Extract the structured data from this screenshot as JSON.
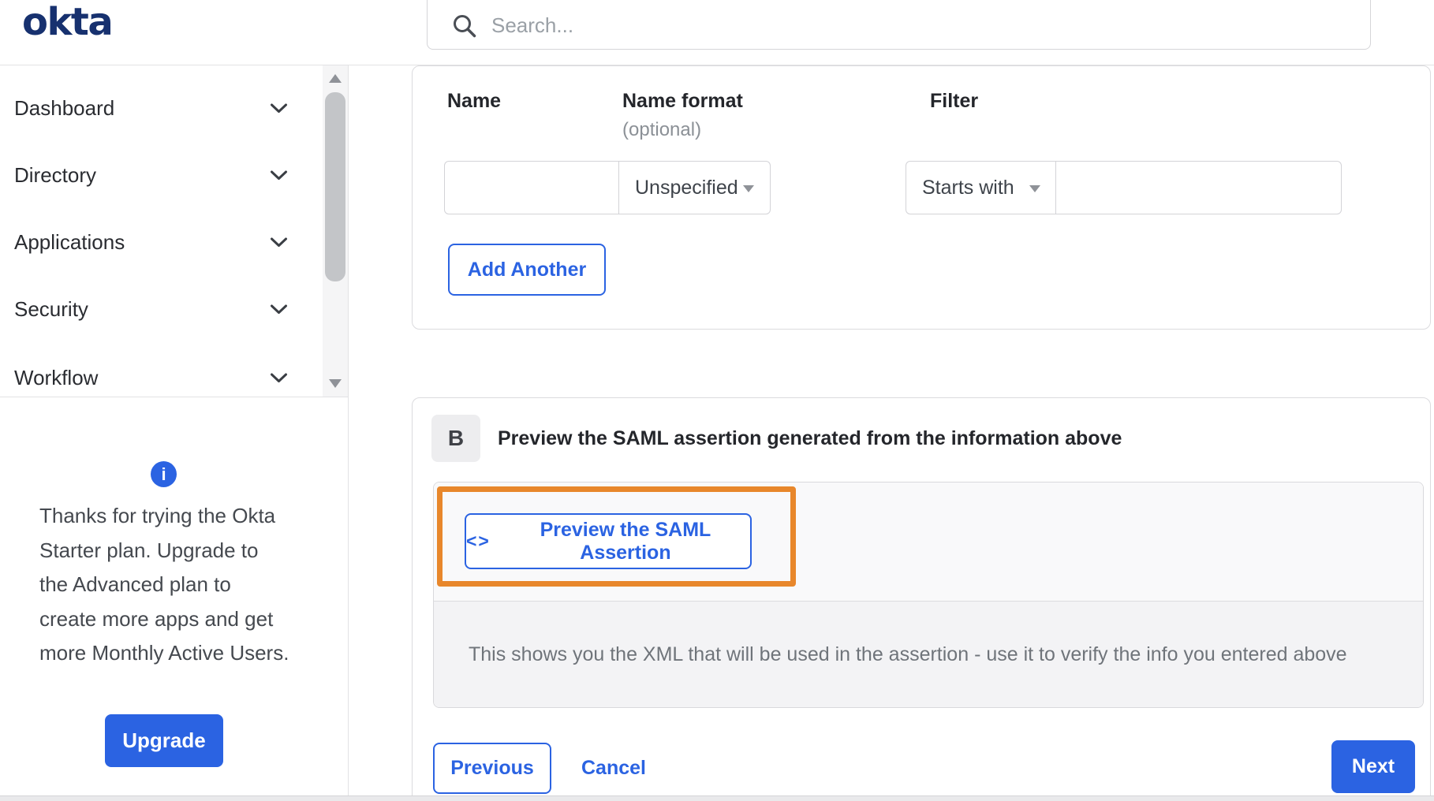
{
  "brand": {
    "logo_text": "okta"
  },
  "search": {
    "placeholder": "Search..."
  },
  "icons": {
    "info_glyph": "i"
  },
  "sidebar": {
    "items": [
      "Dashboard",
      "Directory",
      "Applications",
      "Security",
      "Workflow"
    ],
    "plan_notice_lines": [
      "Thanks for trying the Okta",
      "Starter plan. Upgrade to",
      "the Advanced plan to",
      "create more apps and get",
      "more Monthly Active Users."
    ],
    "upgrade_label": "Upgrade"
  },
  "attribute_form": {
    "name_label": "Name",
    "name_format_label": "Name format",
    "name_format_sublabel": "(optional)",
    "filter_label": "Filter",
    "name_value": "",
    "name_format_value": "Unspecified",
    "filter_operator_value": "Starts with",
    "filter_value": "",
    "add_another_label": "Add Another"
  },
  "preview_section": {
    "badge": "B",
    "title": "Preview the SAML assertion generated from the information above",
    "preview_button_icon": "<>",
    "preview_button_label": "Preview the SAML Assertion",
    "description": "This shows you the XML that will be used in the assertion - use it to verify the info you entered above"
  },
  "wizard_footer": {
    "previous_label": "Previous",
    "cancel_label": "Cancel",
    "next_label": "Next"
  },
  "colors": {
    "accent_blue": "#2b63e2",
    "okta_navy": "#17316f",
    "annotation_orange": "#e8872b",
    "panel_gray": "#f3f3f5"
  }
}
